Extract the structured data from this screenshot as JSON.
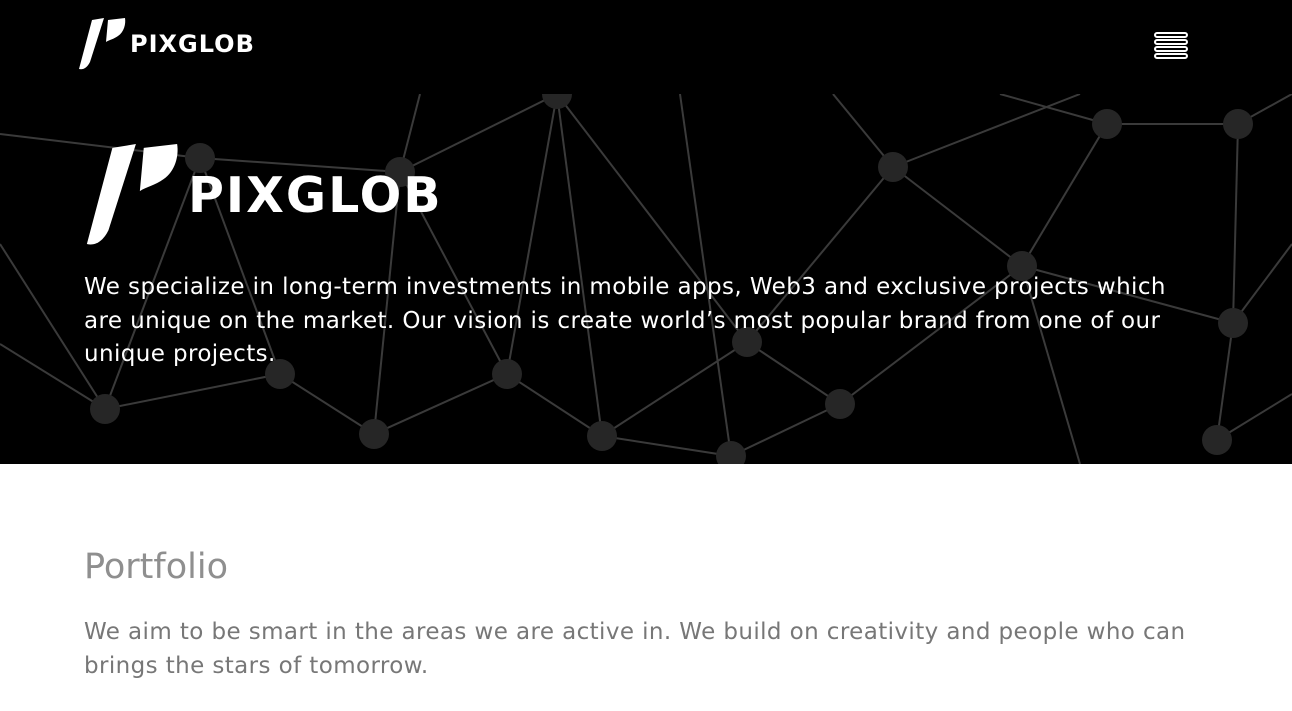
{
  "header": {
    "brand_name": "PIXGLOB",
    "logo_icon": "pixglob-logo-mark",
    "menu_icon": "hamburger-menu-icon",
    "background_color": "#000000"
  },
  "hero": {
    "brand_name": "PIXGLOB",
    "logo_icon": "pixglob-logo-mark",
    "background_icon": "network-graph-background",
    "tagline": "We specialize in long-term investments in mobile apps, Web3 and exclusive projects which are unique on the market. Our vision is create world’s most popular brand from one of our unique projects.",
    "background_color": "#000000",
    "text_color": "#ffffff"
  },
  "portfolio": {
    "title": "Portfolio",
    "description": "We aim to be smart in the areas we are active in. We build on creativity and people who can brings the stars of tomorrow.",
    "title_color": "#8f8f8f",
    "text_color": "#777777"
  }
}
